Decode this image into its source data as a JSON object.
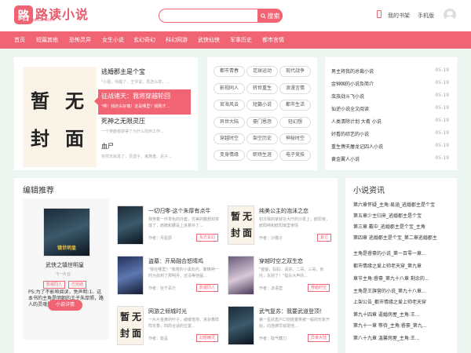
{
  "header": {
    "logo_char": "路",
    "logo_text": "路读小说",
    "logo_url": "www.xpeitu.com",
    "search_placeholder": "",
    "search_label": "搜索",
    "bookshelf": "我的书架",
    "mobile": "手机版"
  },
  "nav": [
    "首页",
    "短篇其他",
    "恐怖灵异",
    "女生小说",
    "玄幻奇幻",
    "科幻网游",
    "武侠仙侠",
    "军事历史",
    "都市言情"
  ],
  "hot": {
    "cover_chars": [
      "暂",
      "无",
      "封",
      "面"
    ],
    "items": [
      {
        "title": "逃婚郡主是个宝",
        "desc": "\"小姐，你醒了，王爷说，再怎么样，..."
      },
      {
        "title": "征战诸天：我将穿越轮回",
        "desc": "\"啊！我的头好痛！这是哪里？我刚才..."
      },
      {
        "title": "死神之无限灵压",
        "desc": "一个穿越者获得了为什么找到工作..."
      },
      {
        "title": "血尸",
        "desc": "突然天就黑了，灵遗子、鬼算盘、泥子..."
      }
    ]
  },
  "tags": [
    "都市青春",
    "足球运动",
    "现代战争",
    "影视同人",
    "转世重生",
    "浪漫言情",
    "官海风云",
    "短篇小说",
    "都市生活",
    "异世大陆",
    "豪门恩怨",
    "轻幻想",
    "穿越时空",
    "架空历史",
    "神秘时空",
    "变身情缘",
    "职场生涯",
    "电子竞技"
  ],
  "recommend": [
    {
      "title": "男主将我的总裁小说",
      "date": "05-19"
    },
    {
      "title": "金钟国的小说及简介",
      "date": "05-19"
    },
    {
      "title": "虫族战斗飞小说",
      "date": "05-19"
    },
    {
      "title": "仙逆小说全文阅读",
      "date": "05-19"
    },
    {
      "title": "人类清除计划 大肴 小说",
      "date": "05-19"
    },
    {
      "title": "好看的综艺的小说",
      "date": "05-19"
    },
    {
      "title": "重生傅夫屠龙记四人小说",
      "date": "05-19"
    },
    {
      "title": "黄金翼人小说",
      "date": "05-19"
    }
  ],
  "editor": {
    "heading": "编辑推荐",
    "featured": {
      "title": "武侠之镇世明皇",
      "cover_text": "镇世明皇",
      "author": "飞一片云",
      "tags": [
        "影视同人",
        "已完结"
      ],
      "desc": "PS:为了不影响阅读，免声明:1、这本书的主角是明朝的王子朱厚照，路人的灵魂是融合在一起...",
      "button": "小说详情"
    },
    "books": [
      {
        "title": "一切归零-这个朱厚有点牛",
        "desc": "我穿着一件草色的外套，优美的腹部却变成了，肩膀和腰是上进着补丁...",
        "author": "作者：月星辰",
        "tag": "东方玄幻"
      },
      {
        "title": "纯美公主的泡沫之恋",
        "desc": "初次我的家就在大厅的沙发上，欧阳夜，欧阳纯和欧阳璃里亲情",
        "author": "作者：沙猫子",
        "tag": "其它"
      },
      {
        "title": "盗墓：开局融合怒晴鸡",
        "desc": "\"我在哪里？\"我慢的小溪向内，聚精神一时为找到了那明月，还没等他猛...",
        "author": "作者：狂千百万",
        "tag": "影视同人"
      },
      {
        "title": "穿越时空之双生恋",
        "desc": "\"爸爸，妈妈，请进，二哥，三哥，肯托，永别了！\"指尖大声的...",
        "author": "作者：汲语营",
        "tag": "穿越时空"
      },
      {
        "title": "网游之倾城时光",
        "desc": "一片片金黄的叶子，缓缓落地，夹杂着阵阵花香，四周合适的位置...",
        "author": "作者：能呈",
        "tag": "幻想精灵"
      },
      {
        "title": "武气复苏：我要武道登顶！",
        "desc": "第一星武直户口刻度童笑被一般的形象开始，向连铸早就把他...",
        "author": "作者：取气藏刀",
        "tag": "异世大陆"
      }
    ]
  },
  "news": {
    "heading": "小说资讯",
    "items": [
      "第六章怀疑_主角:易涵_逃婚郡主是个宝",
      "第五章少主归来_逃婚郡主是个宝",
      "第三章 戴中_逃婚郡主是个宝_主角",
      "第四章 逃婚郡主是个宝_第二章逃婚郡主",
      "主角是睿豪的小说_第一百零一章...",
      "都市情缘之爱上帅老天穿_第九章",
      "章节主角:睿豪_第九十八章 剩余的...",
      "主角是王旗营的小说_第九十八章...",
      "上架公告_都市情缘之爱上帅老天穿",
      "第九十四章 逼婚房屋_主角:王...",
      "第九十一章 等待_主角:睿豪_第九...",
      "第八十九章 温馨房屋_主角:王...",
      "第九十章 等待_主角:睿豪_第九...",
      "第八十九章 我想我们该聊聊了..."
    ]
  },
  "colors": {
    "accent": "#f06473",
    "bg": "#edf6f1"
  }
}
